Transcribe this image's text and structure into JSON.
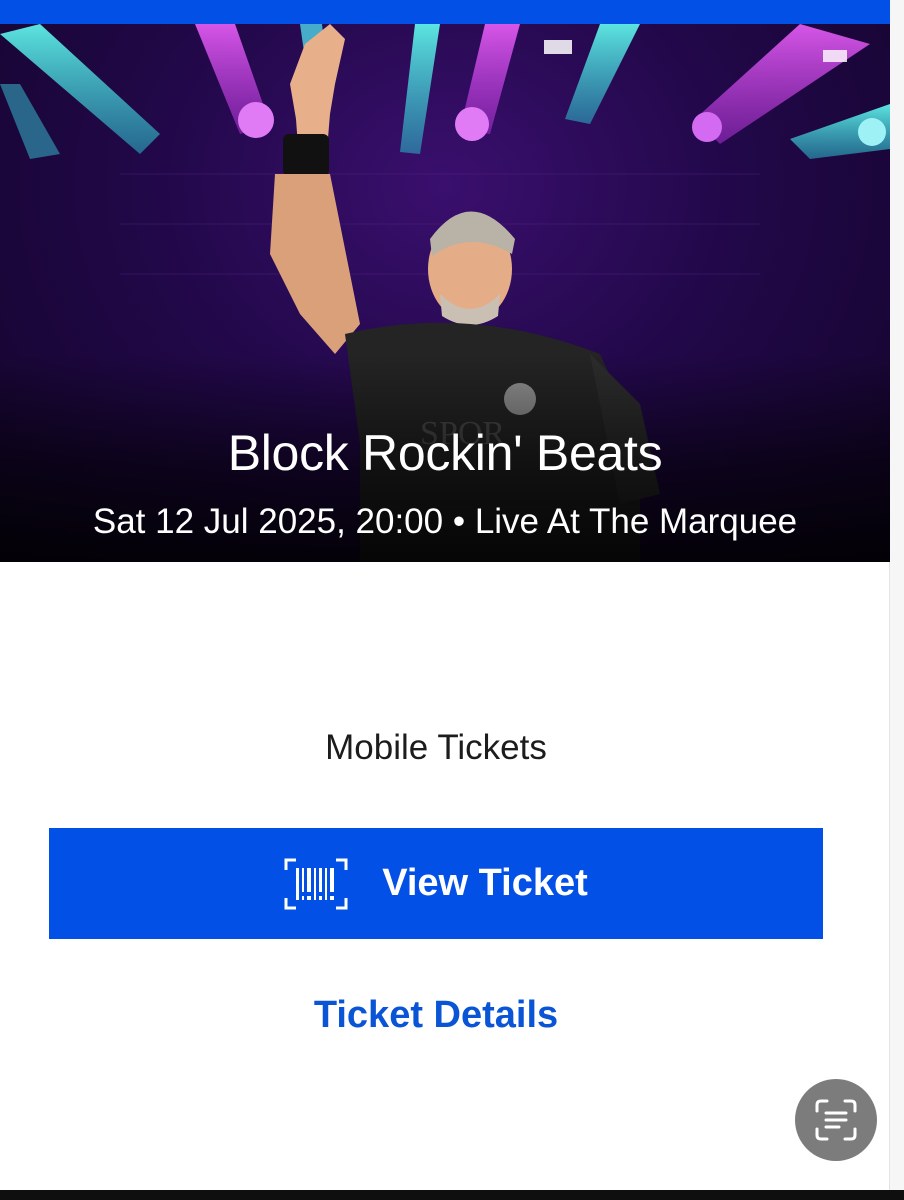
{
  "event": {
    "title": "Block Rockin' Beats",
    "meta": "Sat 12 Jul 2025, 20:00 • Live At The Marquee"
  },
  "tickets": {
    "section_label": "Mobile Tickets",
    "view_ticket_label": "View Ticket",
    "view_ticket_icon": "barcode-scan-icon",
    "details_label": "Ticket Details"
  },
  "fab": {
    "icon": "text-scan-icon"
  },
  "colors": {
    "accent": "#0350e6",
    "link": "#0a55d6",
    "fab": "#7c7c7c"
  }
}
